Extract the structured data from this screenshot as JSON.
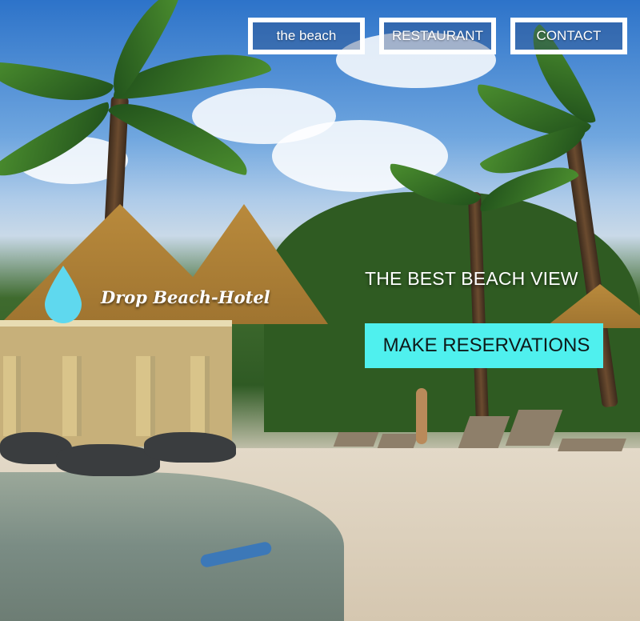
{
  "nav": {
    "items": [
      {
        "label": "the beach"
      },
      {
        "label": "RESTAURANT"
      },
      {
        "label": "CONTACT"
      }
    ]
  },
  "logo": {
    "icon": "water-drop-icon",
    "text": "Drop Beach-Hotel",
    "color": "#5fd8ee"
  },
  "hero": {
    "tagline": "THE BEST BEACH VIEW",
    "cta_label": "MAKE RESERVATIONS",
    "cta_color": "#4ff0ee",
    "background_image": "beach-resort-photo"
  }
}
